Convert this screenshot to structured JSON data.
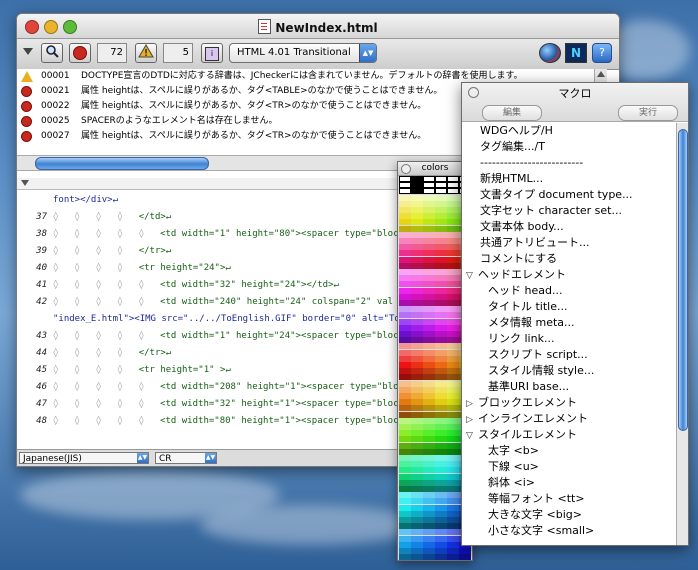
{
  "window": {
    "title": "NewIndex.html"
  },
  "toolbar": {
    "error_count": "72",
    "warning_count": "5",
    "doctype_selected": "HTML 4.01 Transitional"
  },
  "messages": [
    {
      "type": "warning",
      "code": "00001",
      "text": "DOCTYPE宣言のDTDに対応する辞書は、JCheckerには含まれていません。デフォルトの辞書を使用します。"
    },
    {
      "type": "error",
      "code": "00021",
      "text": "属性 heightは、スペルに誤りがあるか、タグ<TABLE>のなかで使うことはできません。"
    },
    {
      "type": "error",
      "code": "00022",
      "text": "属性 heightは、スペルに誤りがあるか、タグ<TR>のなかで使うことはできません。"
    },
    {
      "type": "error",
      "code": "00025",
      "text": "SPACERのようなエレメント名は存在しません。"
    },
    {
      "type": "error",
      "code": "00027",
      "text": "属性 heightは、スペルに誤りがあるか、タグ<TR>のなかで使うことはできません。"
    }
  ],
  "code_lines": [
    {
      "num": "",
      "text": "font></div>↵",
      "cls": "ctext blue"
    },
    {
      "num": "37",
      "text": "</td>↵",
      "cls": "ctext"
    },
    {
      "num": "38",
      "text": "<td width=\"1\" height=\"80\"><spacer type=\"bloc",
      "cls": "ctext"
    },
    {
      "num": "39",
      "text": "</tr>↵",
      "cls": "ctext"
    },
    {
      "num": "40",
      "text": "<tr height=\"24\">↵",
      "cls": "ctext"
    },
    {
      "num": "41",
      "text": "<td width=\"32\" height=\"24\"></td>↵",
      "cls": "ctext"
    },
    {
      "num": "42",
      "text": "<td width=\"240\" height=\"24\" colspan=\"2\" val",
      "cls": "ctext"
    },
    {
      "num": "",
      "text": "\"index_E.html\"><IMG src=\"../../ToEnglish.GIF\" border=\"0\" alt=\"ToEnglis",
      "cls": "ctext blue"
    },
    {
      "num": "43",
      "text": "<td width=\"1\" height=\"24\"><spacer type=\"bloc",
      "cls": "ctext"
    },
    {
      "num": "44",
      "text": "</tr>↵",
      "cls": "ctext"
    },
    {
      "num": "45",
      "text": "<tr height=\"1\" >↵",
      "cls": "ctext"
    },
    {
      "num": "46",
      "text": "<td width=\"208\" height=\"1\"><spacer type=\"blo",
      "cls": "ctext"
    },
    {
      "num": "47",
      "text": "<td width=\"32\" height=\"1\"><spacer type=\"bloc",
      "cls": "ctext"
    },
    {
      "num": "48",
      "text": "<td width=\"80\" height=\"1\"><spacer type=\"bloc",
      "cls": "ctext"
    }
  ],
  "statusbar": {
    "encoding": "Japanese(JIS)",
    "linebreak": "CR"
  },
  "colors_palette": {
    "title": "colors"
  },
  "macro_palette": {
    "title": "マクロ",
    "edit_button": "編集",
    "run_button": "実行",
    "items": [
      {
        "label": "WDGヘルプ/H",
        "indent": 0,
        "tri": ""
      },
      {
        "label": "タグ編集.../T",
        "indent": 0,
        "tri": ""
      },
      {
        "label": "--------------------------",
        "indent": 0,
        "tri": ""
      },
      {
        "label": "新規HTML...",
        "indent": 0,
        "tri": ""
      },
      {
        "label": "文書タイプ document type...",
        "indent": 0,
        "tri": ""
      },
      {
        "label": "文字セット character set...",
        "indent": 0,
        "tri": ""
      },
      {
        "label": "文書本体 body...",
        "indent": 0,
        "tri": ""
      },
      {
        "label": "共通アトリビュート...",
        "indent": 0,
        "tri": ""
      },
      {
        "label": "コメントにする",
        "indent": 0,
        "tri": ""
      },
      {
        "label": "ヘッドエレメント",
        "indent": 0,
        "tri": "▽"
      },
      {
        "label": "ヘッド head...",
        "indent": 1,
        "tri": ""
      },
      {
        "label": "タイトル title...",
        "indent": 1,
        "tri": ""
      },
      {
        "label": "メタ情報 meta...",
        "indent": 1,
        "tri": ""
      },
      {
        "label": "リンク link...",
        "indent": 1,
        "tri": ""
      },
      {
        "label": "スクリプト script...",
        "indent": 1,
        "tri": ""
      },
      {
        "label": "スタイル情報 style...",
        "indent": 1,
        "tri": ""
      },
      {
        "label": "基準URI base...",
        "indent": 1,
        "tri": ""
      },
      {
        "label": "ブロックエレメント",
        "indent": 0,
        "tri": "▷"
      },
      {
        "label": "インラインエレメント",
        "indent": 0,
        "tri": "▷"
      },
      {
        "label": "スタイルエレメント",
        "indent": 0,
        "tri": "▽"
      },
      {
        "label": "太字 <b>",
        "indent": 1,
        "tri": ""
      },
      {
        "label": "下線 <u>",
        "indent": 1,
        "tri": ""
      },
      {
        "label": "斜体 <i>",
        "indent": 1,
        "tri": ""
      },
      {
        "label": "等幅フォント <tt>",
        "indent": 1,
        "tri": ""
      },
      {
        "label": "大きな文字 <big>",
        "indent": 1,
        "tri": ""
      },
      {
        "label": "小さな文字 <small>",
        "indent": 1,
        "tri": ""
      }
    ]
  },
  "colors": {
    "stop": "#c8281e",
    "warning": "#e8b020",
    "accent": "#3f82d4",
    "code_green": "#166016"
  }
}
